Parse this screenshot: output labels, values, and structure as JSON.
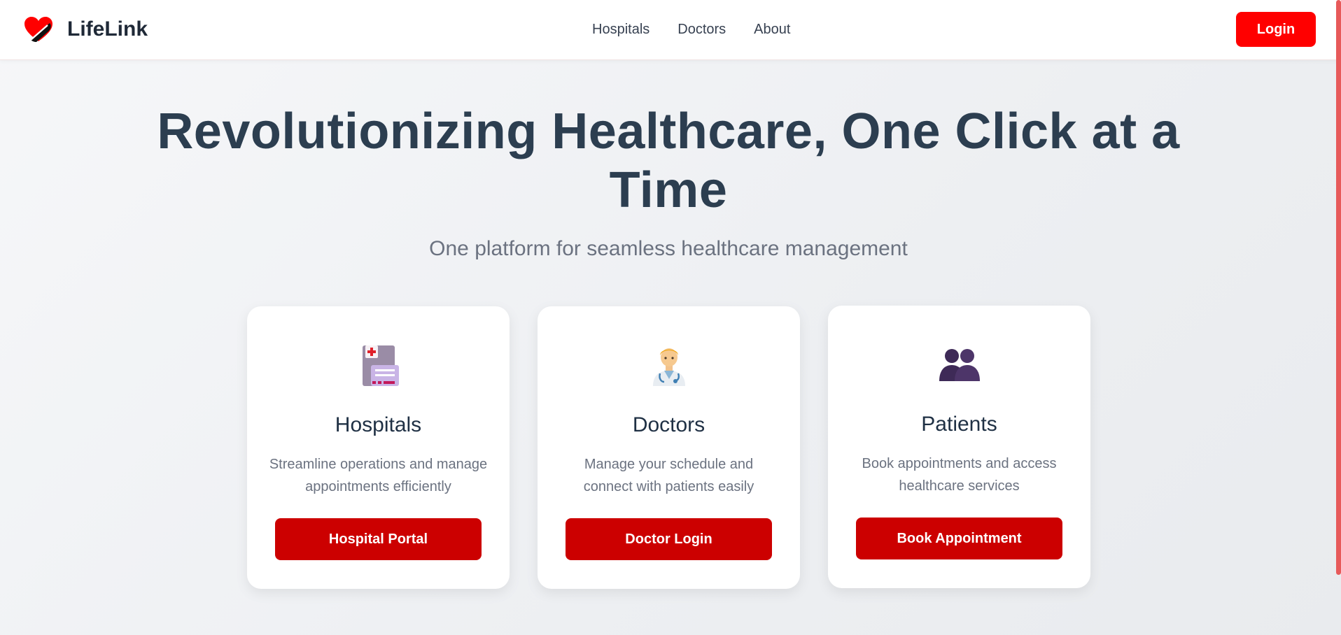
{
  "brand": {
    "name": "LifeLink",
    "logo_icon": "heart-icon",
    "accent": "#ff0000"
  },
  "nav": {
    "links": [
      "Hospitals",
      "Doctors",
      "About"
    ],
    "login_label": "Login"
  },
  "hero": {
    "title": "Revolutionizing Healthcare, One Click at a Time",
    "subtitle": "One platform for seamless healthcare management"
  },
  "cards": [
    {
      "icon": "hospital-icon",
      "title": "Hospitals",
      "description": "Streamline operations and manage appointments efficiently",
      "button": "Hospital Portal"
    },
    {
      "icon": "doctor-icon",
      "title": "Doctors",
      "description": "Manage your schedule and connect with patients easily",
      "button": "Doctor Login"
    },
    {
      "icon": "patients-icon",
      "title": "Patients",
      "description": "Book appointments and access healthcare services",
      "button": "Book Appointment"
    }
  ],
  "colors": {
    "button_red": "#cc0000",
    "heading": "#2c3e50",
    "muted": "#6b7280"
  }
}
